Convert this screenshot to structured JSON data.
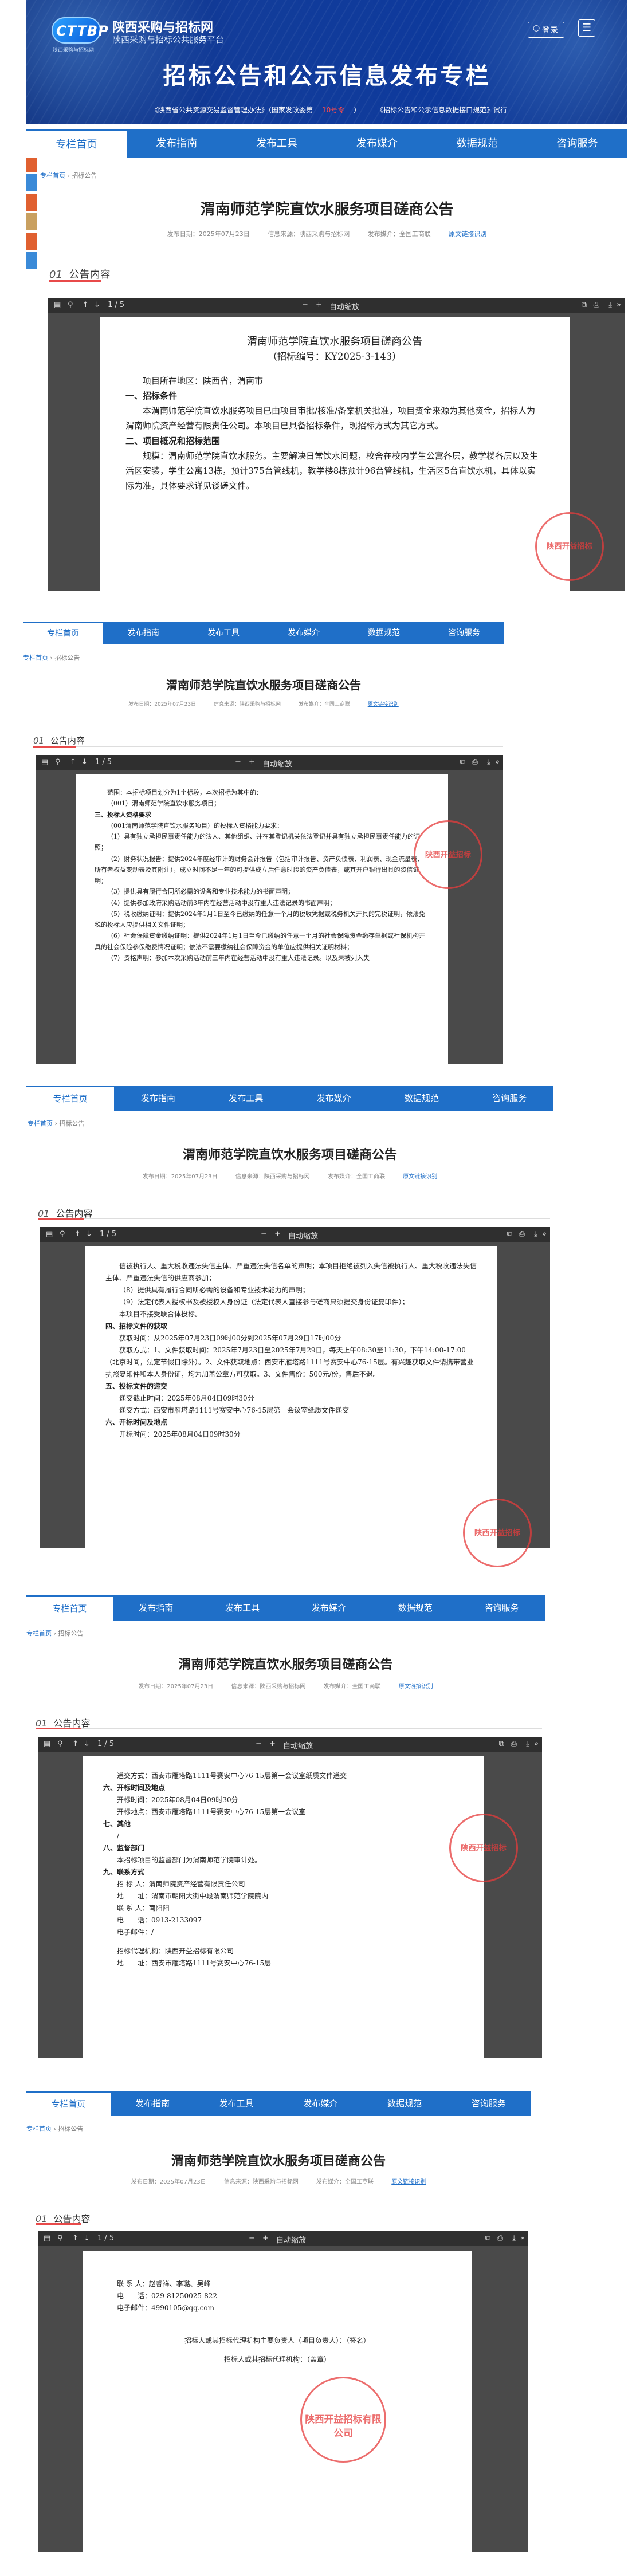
{
  "site": {
    "logo": "CTTBP",
    "logo_sub": "陕西采购与招标网",
    "name": "陕西采购与招标网",
    "subname": "陕西采购与招标公共服务平台",
    "login": "登录",
    "menu_icon": "menu-icon"
  },
  "banner": {
    "title": "招标公告和公示信息发布专栏",
    "notices": [
      "《陕西省公共资源交易监督管理办法》（国家发改委第",
      "10号令",
      "）",
      "《招标公告和公示信息数据接口规范》试行"
    ]
  },
  "nav": [
    "专栏首页",
    "发布指南",
    "发布工具",
    "发布媒介",
    "数据规范",
    "咨询服务"
  ],
  "breadcrumb": {
    "home": "专栏首页",
    "sep": "›",
    "current": "招标公告"
  },
  "notice": {
    "title": "渭南师范学院直饮水服务项目磋商公告",
    "date": "发布日期：2025年07月23日",
    "source": "信息来源：陕西采购与招标网",
    "media": "发布媒介：全国工商联",
    "action": "原文链接识别"
  },
  "section": {
    "num": "01",
    "label": "公告内容"
  },
  "toolbar": {
    "page": "1 / 5",
    "zoom": "自动缩放"
  },
  "doc_p1": {
    "title": "渭南师范学院直饮水服务项目磋商公告",
    "number": "（招标编号：KY2025-3-143）",
    "region": "项目所在地区：陕西省，渭南市",
    "h1": "一、招标条件",
    "p1": "本渭南师范学院直饮水服务项目已由项目审批/核准/备案机关批准，项目资金来源为其他资金，招标人为渭南师院资产经营有限责任公司。本项目已具备招标条件，现招标方式为其它方式。",
    "h2": "二、项目概况和招标范围",
    "p2": "规模：渭南师范学院直饮水服务。主要解决日常饮水问题，校舍在校内学生公寓各层，教学楼各层以及生活区安装，学生公寓13栋，预计375台管线机，教学楼8栋预计96台管线机，生活区5台直饮水机，具体以实际为准，具体要求详见谈磋文件。"
  },
  "doc_p2": {
    "p1": "范围：本招标项目划分为1个标段，本次招标为其中的：",
    "p2": "（001）渭南师范学院直饮水服务项目；",
    "h3": "三、投标人资格要求",
    "p3": "（001渭南师范学院直饮水服务项目）的投标人资格能力要求：",
    "p4": "（1）具有独立承担民事责任能力的法人、其他组织、并在其登记机关依法登记并具有独立承担民事责任能力的证照；",
    "p5": "（2）财务状况报告：提供2024年度经审计的财务会计报告（包括审计报告、资产负债表、利润表、现金流量表、所有者权益变动表及其附注），成立时间不足一年的可提供成立后任意时段的资产负债表，或其开户银行出具的资信证明；",
    "p6": "（3）提供具有履行合同所必需的设备和专业技术能力的书面声明；",
    "p7": "（4）提供参加政府采购活动前3年内在经营活动中没有重大违法记录的书面声明；",
    "p8": "（5）税收缴纳证明：提供2024年1月1日至今已缴纳的任意一个月的税收凭据或税务机关开具的完税证明，依法免税的投标人应提供相关文件证明；",
    "p9": "（6）社会保障资金缴纳证明：提供2024年1月1日至今已缴纳的任意一个月的社会保障资金缴存单据或社保机构开具的社会保险参保缴费情况证明；依法不需要缴纳社会保障资金的单位应提供相关证明材料；",
    "p10": "（7）资格声明：参加本次采购活动前三年内在经营活动中没有重大违法记录。以及未被列入失"
  },
  "doc_p3": {
    "p1": "信被执行人、重大税收违法失信主体、严重违法失信名单的声明；本项目拒绝被列入失信被执行人、重大税收违法失信主体、严重违法失信的供应商参加；",
    "p2": "（8）提供具有履行合同所必需的设备和专业技术能力的声明；",
    "p3": "（9）法定代表人授权书及被授权人身份证（法定代表人直接参与磋商只须提交身份证复印件）；",
    "p4": "本项目不接受联合体投标。",
    "h4": "四、招标文件的获取",
    "p5": "获取时间：从2025年07月23日09时00分到2025年07月29日17时00分",
    "p6": "获取方式：1、文件获取时间：2025年7月23日至2025年7月29日，每天上午08:30至11:30，下午14:00-17:00（北京时间，法定节假日除外）。2、文件获取地点：西安市雁塔路1111号赛安中心76-15层。有兴趣获取文件请携带营业执照复印件和本人身份证，均为加盖公章方可获取。3、文件售价：500元/份，售后不退。",
    "h5": "五、投标文件的递交",
    "p7": "递交截止时间：2025年08月04日09时30分",
    "p8": "递交方式：西安市雁塔路1111号赛安中心76-15层第一会议室纸质文件递交",
    "h6": "六、开标时间及地点",
    "p9": "开标时间：2025年08月04日09时30分"
  },
  "doc_p4": {
    "p1": "递交方式：西安市雁塔路1111号赛安中心76-15层第一会议室纸质文件递交",
    "h6": "六、开标时间及地点",
    "p2": "开标时间：2025年08月04日09时30分",
    "p3": "开标地点：西安市雁塔路1111号赛安中心76-15层第一会议室",
    "h7": "七、其他",
    "p4": "/",
    "h8": "八、监督部门",
    "p5": "本招标项目的监督部门为渭南师范学院审计处。",
    "h9": "九、联系方式",
    "c1": "招 标 人：渭南师院资产经营有限责任公司",
    "c2": "地　　址：渭南市朝阳大街中段渭南师范学院院内",
    "c3": "联 系 人：南阳阳",
    "c4": "电　　话：0913-2133097",
    "c5": "电子邮件：/",
    "c6": "招标代理机构：陕西开益招标有限公司",
    "c7": "地　　址：西安市雁塔路1111号赛安中心76-15层"
  },
  "doc_p5": {
    "c1": "联 系 人：赵睿祥、李璐、吴峰",
    "c2": "电　　话：029-81250025-822",
    "c3": "电子邮件：4990105@qq.com",
    "s1": "招标人或其招标代理机构主要负责人（项目负责人）：（签名）",
    "s2": "招标人或其招标代理机构：（盖章）"
  },
  "stamps": [
    "陕西开益招标",
    "陕西开益招标",
    "陕西开益招标",
    "陕西开益招标",
    "陕西开益招标有限公司"
  ],
  "colors": {
    "nav": "#1f6fc8",
    "accent": "#e84a4a",
    "banner": "#123c9a"
  }
}
